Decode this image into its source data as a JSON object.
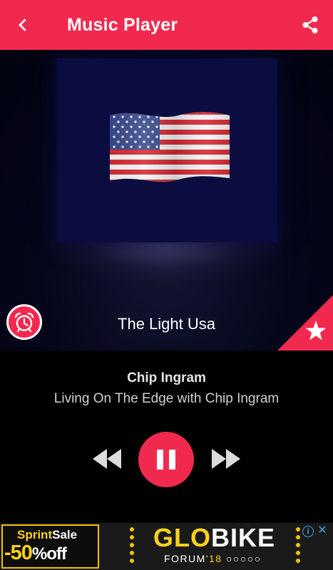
{
  "app_bar": {
    "title": "Music Player",
    "back_icon": "chevron-left-icon",
    "share_icon": "share-icon",
    "color": "#f2294e"
  },
  "station": {
    "name": "The Light Usa",
    "artwork": "us-flag"
  },
  "now_playing": {
    "artist": "Chip Ingram",
    "title": "Living On The Edge with Chip Ingram"
  },
  "controls": {
    "rewind_icon": "rewind-icon",
    "pause_icon": "pause-icon",
    "fast_forward_icon": "fast-forward-icon",
    "timer_icon": "alarm-clock-icon",
    "favorite_icon": "star-icon"
  },
  "ad": {
    "left_brand": "Sprint",
    "left_brand_suffix": "Sale",
    "left_discount": "-50",
    "left_discount_suffix": "%off",
    "main_brand_a": "GLO",
    "main_brand_b": "BIKE",
    "main_sub": "FORUM",
    "main_year": "'18",
    "info_icon": "info-icon",
    "close_icon": "close-icon"
  }
}
